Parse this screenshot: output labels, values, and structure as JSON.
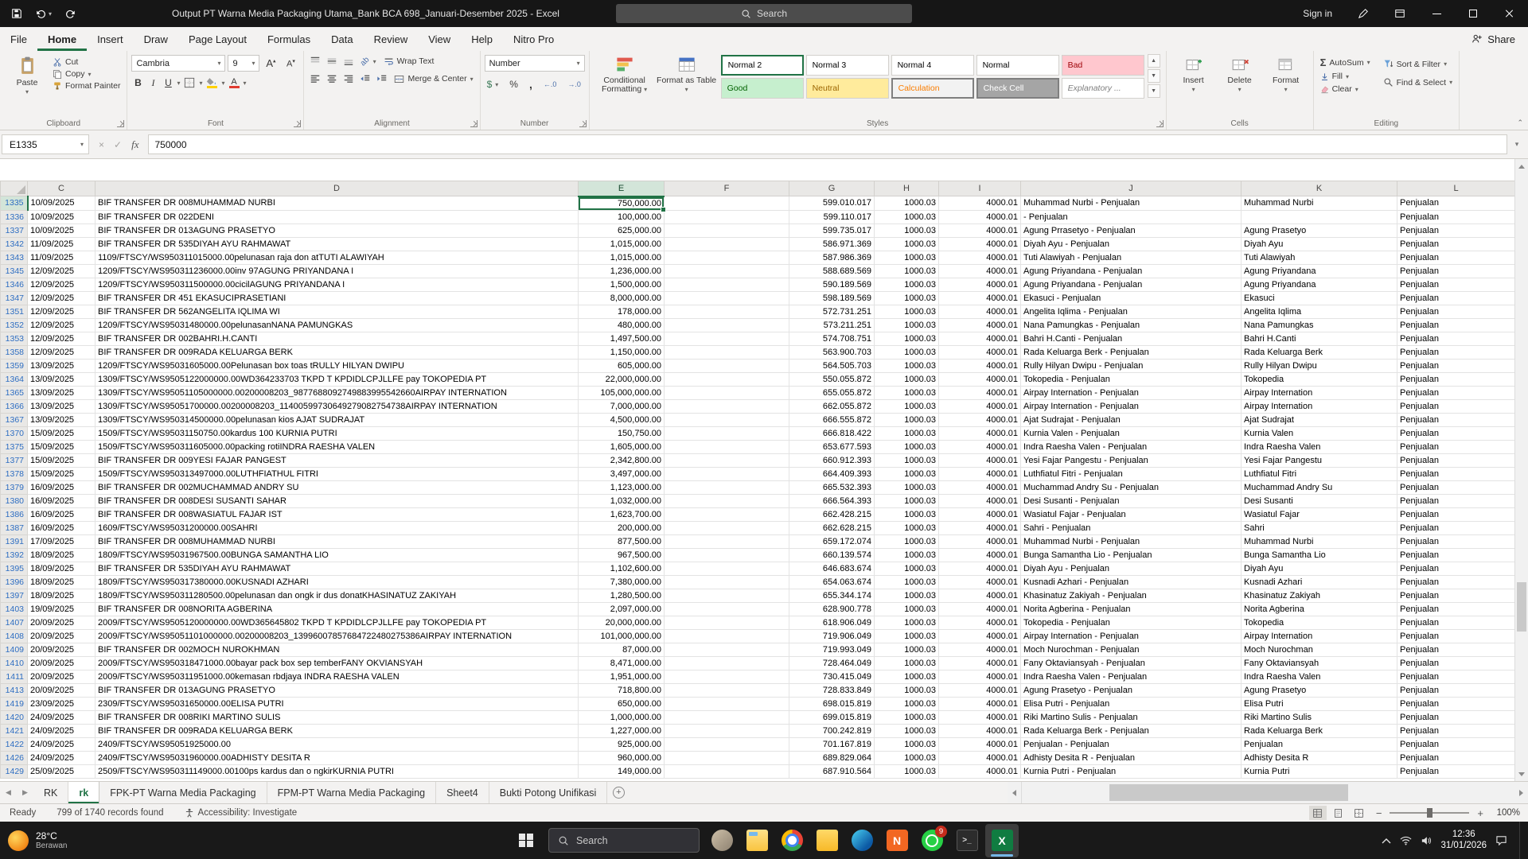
{
  "title_bar": {
    "title": "Output PT Warna Media Packaging Utama_Bank BCA 698_Januari-Desember 2025  -  Excel",
    "search": "Search",
    "sign_in": "Sign in"
  },
  "menu": {
    "tabs": [
      "File",
      "Home",
      "Insert",
      "Draw",
      "Page Layout",
      "Formulas",
      "Data",
      "Review",
      "View",
      "Help",
      "Nitro Pro"
    ],
    "active": "Home",
    "share": "Share"
  },
  "ribbon": {
    "clipboard": {
      "label": "Clipboard",
      "paste": "Paste",
      "cut": "Cut",
      "copy": "Copy",
      "format_painter": "Format Painter"
    },
    "font": {
      "label": "Font",
      "family": "Cambria",
      "size": "9"
    },
    "alignment": {
      "label": "Alignment",
      "wrap_text": "Wrap Text",
      "merge_center": "Merge & Center"
    },
    "number": {
      "label": "Number",
      "format": "Number"
    },
    "styles": {
      "label": "Styles",
      "conditional_formatting": "Conditional Formatting",
      "format_as_table": "Format as Table",
      "gallery": [
        {
          "label": "Normal 2",
          "bg": "#ffffff",
          "color": "#000000",
          "selected": true
        },
        {
          "label": "Normal 3",
          "bg": "#ffffff",
          "color": "#000000"
        },
        {
          "label": "Normal 4",
          "bg": "#ffffff",
          "color": "#000000"
        },
        {
          "label": "Normal",
          "bg": "#ffffff",
          "color": "#000000"
        },
        {
          "label": "Bad",
          "bg": "#ffc7ce",
          "color": "#9c0006"
        },
        {
          "label": "Good",
          "bg": "#c6efce",
          "color": "#006100"
        },
        {
          "label": "Neutral",
          "bg": "#ffeb9c",
          "color": "#9c6500"
        },
        {
          "label": "Calculation",
          "bg": "#f2f2f2",
          "color": "#fa7d00",
          "bordered": true
        },
        {
          "label": "Check Cell",
          "bg": "#a5a5a5",
          "color": "#ffffff",
          "bordered": true
        },
        {
          "label": "Explanatory ...",
          "bg": "#ffffff",
          "color": "#7f7f7f",
          "italic": true
        }
      ]
    },
    "cells": {
      "label": "Cells",
      "insert": "Insert",
      "delete": "Delete",
      "format": "Format"
    },
    "editing": {
      "label": "Editing",
      "autosum": "AutoSum",
      "fill": "Fill",
      "clear": "Clear",
      "sort_filter": "Sort & Filter",
      "find_select": "Find & Select"
    }
  },
  "formula_bar": {
    "name_box": "E1335",
    "value": "750000"
  },
  "grid": {
    "columns": [
      "C",
      "D",
      "E",
      "F",
      "G",
      "H",
      "I",
      "J",
      "K",
      "L"
    ],
    "selected": {
      "row": "1335",
      "col": "E"
    },
    "rows": [
      [
        "1335",
        "10/09/2025",
        "BIF TRANSFER DR 008MUHAMMAD NURBI",
        "750,000.00",
        "599.010.017",
        "1000.03",
        "4000.01",
        "Muhammad Nurbi - Penjualan",
        "Muhammad Nurbi",
        "Penjualan"
      ],
      [
        "1336",
        "10/09/2025",
        "BIF TRANSFER DR 022DENI",
        "100,000.00",
        "599.110.017",
        "1000.03",
        "4000.01",
        "- Penjualan",
        "",
        "Penjualan"
      ],
      [
        "1337",
        "10/09/2025",
        "BIF TRANSFER DR 013AGUNG PRASETYO",
        "625,000.00",
        "599.735.017",
        "1000.03",
        "4000.01",
        "Agung Prrasetyo - Penjualan",
        "Agung Prasetyo",
        "Penjualan"
      ],
      [
        "1342",
        "11/09/2025",
        "BIF TRANSFER DR 535DIYAH AYU RAHMAWAT",
        "1,015,000.00",
        "586.971.369",
        "1000.03",
        "4000.01",
        "Diyah Ayu - Penjualan",
        "Diyah Ayu",
        "Penjualan"
      ],
      [
        "1343",
        "11/09/2025",
        "1109/FTSCY/WS950311015000.00pelunasan raja don atTUTI ALAWIYAH",
        "1,015,000.00",
        "587.986.369",
        "1000.03",
        "4000.01",
        "Tuti Alawiyah - Penjualan",
        "Tuti Alawiyah",
        "Penjualan"
      ],
      [
        "1345",
        "12/09/2025",
        "1209/FTSCY/WS950311236000.00inv 97AGUNG PRIYANDANA I",
        "1,236,000.00",
        "588.689.569",
        "1000.03",
        "4000.01",
        "Agung Priyandana - Penjualan",
        "Agung Priyandana",
        "Penjualan"
      ],
      [
        "1346",
        "12/09/2025",
        "1209/FTSCY/WS950311500000.00cicilAGUNG PRIYANDANA I",
        "1,500,000.00",
        "590.189.569",
        "1000.03",
        "4000.01",
        "Agung Priyandana - Penjualan",
        "Agung Priyandana",
        "Penjualan"
      ],
      [
        "1347",
        "12/09/2025",
        "BIF TRANSFER DR 451 EKASUCIPRASETIANI",
        "8,000,000.00",
        "598.189.569",
        "1000.03",
        "4000.01",
        "Ekasuci - Penjualan",
        "Ekasuci",
        "Penjualan"
      ],
      [
        "1351",
        "12/09/2025",
        "BIF TRANSFER DR 562ANGELITA IQLIMA WI",
        "178,000.00",
        "572.731.251",
        "1000.03",
        "4000.01",
        "Angelita Iqlima - Penjualan",
        "Angelita Iqlima",
        "Penjualan"
      ],
      [
        "1352",
        "12/09/2025",
        "1209/FTSCY/WS95031480000.00pelunasanNANA PAMUNGKAS",
        "480,000.00",
        "573.211.251",
        "1000.03",
        "4000.01",
        "Nana Pamungkas - Penjualan",
        "Nana Pamungkas",
        "Penjualan"
      ],
      [
        "1353",
        "12/09/2025",
        "BIF TRANSFER DR 002BAHRI.H.CANTI",
        "1,497,500.00",
        "574.708.751",
        "1000.03",
        "4000.01",
        "Bahri H.Canti - Penjualan",
        "Bahri H.Canti",
        "Penjualan"
      ],
      [
        "1358",
        "12/09/2025",
        "BIF TRANSFER DR 009RADA KELUARGA BERK",
        "1,150,000.00",
        "563.900.703",
        "1000.03",
        "4000.01",
        "Rada Keluarga Berk - Penjualan",
        "Rada Keluarga Berk",
        "Penjualan"
      ],
      [
        "1359",
        "13/09/2025",
        "1209/FTSCY/WS95031605000.00Pelunasan box toas tRULLY HILYAN DWIPU",
        "605,000.00",
        "564.505.703",
        "1000.03",
        "4000.01",
        "Rully Hilyan Dwipu - Penjualan",
        "Rully Hilyan Dwipu",
        "Penjualan"
      ],
      [
        "1364",
        "13/09/2025",
        "1309/FTSCY/WS9505122000000.00WD364233703 TKPD T KPDIDLCPJLLFE pay TOKOPEDIA PT",
        "22,000,000.00",
        "550.055.872",
        "1000.03",
        "4000.01",
        "Tokopedia - Penjualan",
        "Tokopedia",
        "Penjualan"
      ],
      [
        "1365",
        "13/09/2025",
        "1309/FTSCY/WS95051105000000.00200008203_9877688092749883995542660AIRPAY INTERNATION",
        "105,000,000.00",
        "655.055.872",
        "1000.03",
        "4000.01",
        "Airpay Internation - Penjualan",
        "Airpay Internation",
        "Penjualan"
      ],
      [
        "1366",
        "13/09/2025",
        "1309/FTSCY/WS95051700000.00200008203_11400599730649279082754738AIRPAY INTERNATION",
        "7,000,000.00",
        "662.055.872",
        "1000.03",
        "4000.01",
        "Airpay Internation - Penjualan",
        "Airpay Internation",
        "Penjualan"
      ],
      [
        "1367",
        "13/09/2025",
        "1309/FTSCY/WS950314500000.00pelunasan kios AJAT SUDRAJAT",
        "4,500,000.00",
        "666.555.872",
        "1000.03",
        "4000.01",
        "Ajat Sudrajat - Penjualan",
        "Ajat Sudrajat",
        "Penjualan"
      ],
      [
        "1370",
        "15/09/2025",
        "1509/FTSCY/WS95031150750.00kardus 100 KURNIA PUTRI",
        "150,750.00",
        "666.818.422",
        "1000.03",
        "4000.01",
        "Kurnia Valen - Penjualan",
        "Kurnia Valen",
        "Penjualan"
      ],
      [
        "1375",
        "15/09/2025",
        "1509/FTSCY/WS950311605000.00packing rotiINDRA RAESHA VALEN",
        "1,605,000.00",
        "653.677.593",
        "1000.03",
        "4000.01",
        "Indra Raesha Valen - Penjualan",
        "Indra Raesha Valen",
        "Penjualan"
      ],
      [
        "1377",
        "15/09/2025",
        "BIF TRANSFER DR 009YESI FAJAR PANGEST",
        "2,342,800.00",
        "660.912.393",
        "1000.03",
        "4000.01",
        "Yesi Fajar Pangestu - Penjualan",
        "Yesi Fajar Pangestu",
        "Penjualan"
      ],
      [
        "1378",
        "15/09/2025",
        "1509/FTSCY/WS950313497000.00LUTHFIATHUL FITRI",
        "3,497,000.00",
        "664.409.393",
        "1000.03",
        "4000.01",
        "Luthfiatul Fitri - Penjualan",
        "Luthfiatul Fitri",
        "Penjualan"
      ],
      [
        "1379",
        "16/09/2025",
        "BIF TRANSFER DR 002MUCHAMMAD ANDRY SU",
        "1,123,000.00",
        "665.532.393",
        "1000.03",
        "4000.01",
        "Muchammad Andry Su - Penjualan",
        "Muchammad Andry Su",
        "Penjualan"
      ],
      [
        "1380",
        "16/09/2025",
        "BIF TRANSFER DR 008DESI SUSANTI SAHAR",
        "1,032,000.00",
        "666.564.393",
        "1000.03",
        "4000.01",
        "Desi Susanti - Penjualan",
        "Desi Susanti",
        "Penjualan"
      ],
      [
        "1386",
        "16/09/2025",
        "BIF TRANSFER DR 008WASIATUL FAJAR IST",
        "1,623,700.00",
        "662.428.215",
        "1000.03",
        "4000.01",
        "Wasiatul Fajar - Penjualan",
        "Wasiatul Fajar",
        "Penjualan"
      ],
      [
        "1387",
        "16/09/2025",
        "1609/FTSCY/WS95031200000.00SAHRI",
        "200,000.00",
        "662.628.215",
        "1000.03",
        "4000.01",
        "Sahri - Penjualan",
        "Sahri",
        "Penjualan"
      ],
      [
        "1391",
        "17/09/2025",
        "BIF TRANSFER DR 008MUHAMMAD NURBI",
        "877,500.00",
        "659.172.074",
        "1000.03",
        "4000.01",
        "Muhammad Nurbi - Penjualan",
        "Muhammad Nurbi",
        "Penjualan"
      ],
      [
        "1392",
        "18/09/2025",
        "1809/FTSCY/WS95031967500.00BUNGA SAMANTHA LIO",
        "967,500.00",
        "660.139.574",
        "1000.03",
        "4000.01",
        "Bunga Samantha Lio - Penjualan",
        "Bunga Samantha Lio",
        "Penjualan"
      ],
      [
        "1395",
        "18/09/2025",
        "BIF TRANSFER DR 535DIYAH AYU RAHMAWAT",
        "1,102,600.00",
        "646.683.674",
        "1000.03",
        "4000.01",
        "Diyah Ayu - Penjualan",
        "Diyah Ayu",
        "Penjualan"
      ],
      [
        "1396",
        "18/09/2025",
        "1809/FTSCY/WS950317380000.00KUSNADI AZHARI",
        "7,380,000.00",
        "654.063.674",
        "1000.03",
        "4000.01",
        "Kusnadi Azhari - Penjualan",
        "Kusnadi Azhari",
        "Penjualan"
      ],
      [
        "1397",
        "18/09/2025",
        "1809/FTSCY/WS950311280500.00pelunasan dan ongk ir dus donatKHASINATUZ ZAKIYAH",
        "1,280,500.00",
        "655.344.174",
        "1000.03",
        "4000.01",
        "Khasinatuz Zakiyah - Penjualan",
        "Khasinatuz Zakiyah",
        "Penjualan"
      ],
      [
        "1403",
        "19/09/2025",
        "BIF TRANSFER DR 008NORITA AGBERINA",
        "2,097,000.00",
        "628.900.778",
        "1000.03",
        "4000.01",
        "Norita Agberina - Penjualan",
        "Norita Agberina",
        "Penjualan"
      ],
      [
        "1407",
        "20/09/2025",
        "2009/FTSCY/WS9505120000000.00WD365645802 TKPD T KPDIDLCPJLLFE pay TOKOPEDIA PT",
        "20,000,000.00",
        "618.906.049",
        "1000.03",
        "4000.01",
        "Tokopedia - Penjualan",
        "Tokopedia",
        "Penjualan"
      ],
      [
        "1408",
        "20/09/2025",
        "2009/FTSCY/WS95051101000000.00200008203_13996007857684722480275386AIRPAY INTERNATION",
        "101,000,000.00",
        "719.906.049",
        "1000.03",
        "4000.01",
        "Airpay Internation - Penjualan",
        "Airpay Internation",
        "Penjualan"
      ],
      [
        "1409",
        "20/09/2025",
        "BIF TRANSFER DR 002MOCH NUROKHMAN",
        "87,000.00",
        "719.993.049",
        "1000.03",
        "4000.01",
        "Moch Nurochman - Penjualan",
        "Moch Nurochman",
        "Penjualan"
      ],
      [
        "1410",
        "20/09/2025",
        "2009/FTSCY/WS950318471000.00bayar pack box sep temberFANY OKVIANSYAH",
        "8,471,000.00",
        "728.464.049",
        "1000.03",
        "4000.01",
        "Fany Oktaviansyah - Penjualan",
        "Fany Oktaviansyah",
        "Penjualan"
      ],
      [
        "1411",
        "20/09/2025",
        "2009/FTSCY/WS950311951000.00kemasan rbdjaya INDRA RAESHA VALEN",
        "1,951,000.00",
        "730.415.049",
        "1000.03",
        "4000.01",
        "Indra Raesha Valen - Penjualan",
        "Indra Raesha Valen",
        "Penjualan"
      ],
      [
        "1413",
        "20/09/2025",
        "BIF TRANSFER DR 013AGUNG PRASETYO",
        "718,800.00",
        "728.833.849",
        "1000.03",
        "4000.01",
        "Agung Prasetyo - Penjualan",
        "Agung Prasetyo",
        "Penjualan"
      ],
      [
        "1419",
        "23/09/2025",
        "2309/FTSCY/WS95031650000.00ELISA PUTRI",
        "650,000.00",
        "698.015.819",
        "1000.03",
        "4000.01",
        "Elisa Putri - Penjualan",
        "Elisa Putri",
        "Penjualan"
      ],
      [
        "1420",
        "24/09/2025",
        "BIF TRANSFER DR 008RIKI MARTINO SULIS",
        "1,000,000.00",
        "699.015.819",
        "1000.03",
        "4000.01",
        "Riki Martino Sulis - Penjualan",
        "Riki Martino Sulis",
        "Penjualan"
      ],
      [
        "1421",
        "24/09/2025",
        "BIF TRANSFER DR 009RADA KELUARGA BERK",
        "1,227,000.00",
        "700.242.819",
        "1000.03",
        "4000.01",
        "Rada Keluarga Berk - Penjualan",
        "Rada Keluarga Berk",
        "Penjualan"
      ],
      [
        "1422",
        "24/09/2025",
        "2409/FTSCY/WS95051925000.00",
        "925,000.00",
        "701.167.819",
        "1000.03",
        "4000.01",
        "Penjualan - Penjualan",
        "Penjualan",
        "Penjualan"
      ],
      [
        "1426",
        "24/09/2025",
        "2409/FTSCY/WS95031960000.00ADHISTY DESITA R",
        "960,000.00",
        "689.829.064",
        "1000.03",
        "4000.01",
        "Adhisty Desita R - Penjualan",
        "Adhisty Desita R",
        "Penjualan"
      ],
      [
        "1429",
        "25/09/2025",
        "2509/FTSCY/WS950311149000.00100ps kardus dan o ngkirKURNIA PUTRI",
        "149,000.00",
        "687.910.564",
        "1000.03",
        "4000.01",
        "Kurnia Putri - Penjualan",
        "Kurnia Putri",
        "Penjualan"
      ]
    ]
  },
  "sheet_bar": {
    "tabs": [
      {
        "label": "RK"
      },
      {
        "label": "rk",
        "active": true
      },
      {
        "label": "FPK-PT Warna Media Packaging"
      },
      {
        "label": "FPM-PT Warna Media Packaging"
      },
      {
        "label": "Sheet4"
      },
      {
        "label": "Bukti Potong Unifikasi"
      }
    ]
  },
  "status_bar": {
    "mode": "Ready",
    "records": "799 of 1740 records found",
    "accessibility": "Accessibility: Investigate",
    "zoom": "100%"
  },
  "taskbar": {
    "weather": {
      "temp": "28°C",
      "desc": "Berawan"
    },
    "search": "Search",
    "apps": [
      {
        "name": "app-avatar"
      },
      {
        "name": "file-explorer"
      },
      {
        "name": "chrome"
      },
      {
        "name": "folder"
      },
      {
        "name": "edge"
      },
      {
        "name": "nitro",
        "glyph": "N"
      },
      {
        "name": "whatsapp",
        "badge": "9"
      },
      {
        "name": "terminal",
        "glyph": ">_"
      },
      {
        "name": "excel",
        "glyph": "X",
        "active": true
      }
    ],
    "tray": {
      "time": "12:36",
      "date": "31/01/2026"
    }
  },
  "icons": {
    "dropdown": "▾",
    "up": "▴",
    "down": "▾",
    "sigma": "Σ",
    "check": "✓",
    "close": "×",
    "fx": "fx",
    "bold": "B",
    "italic": "I",
    "underline": "U",
    "font_a": "A",
    "orientation": "ab",
    "dollar": "$",
    "percent": "%",
    "comma": ",",
    "inc_decimal": "←.0",
    "dec_decimal": "→.0",
    "left_arrow": "◀",
    "right_arrow": "▶",
    "plus": "+",
    "minus": "−",
    "chevron_up": "⌃"
  }
}
